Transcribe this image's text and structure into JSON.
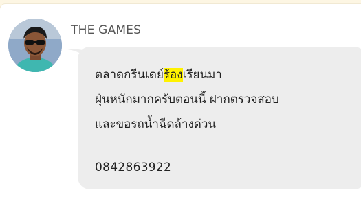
{
  "chat": {
    "sender_name": "THE GAMES",
    "message": {
      "line1_before": "ตลาดกรีนเดย์",
      "line1_highlight": "ร้อง",
      "line1_after": "เรียนมา",
      "line2": "ฝุ่นหนักมากครับตอนนี้ ฝากตรวจสอบ",
      "line3": "และขอรถน้ำฉีดล้างด่วน",
      "phone": "0842863922"
    },
    "colors": {
      "highlight": "#fff200",
      "bubble": "#ededed",
      "background": "#fdf6e3"
    }
  }
}
